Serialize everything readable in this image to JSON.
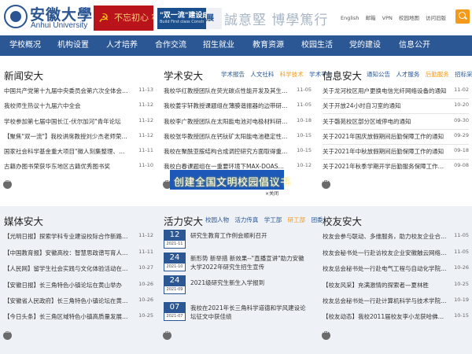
{
  "header": {
    "logo_cn": "安徽大學",
    "logo_en": "Anhui University",
    "banner1": "不忘初心 牢记使命",
    "banner2_title": "\"双一流\"建设成果展",
    "banner2_sub": "Build First class Construction Achievement Exhibition",
    "banner2_tail": "展",
    "motto": "誠意堅 博學篤行",
    "toplinks": [
      "English",
      "邮箱",
      "VPN",
      "校园地图",
      "访问旧版"
    ]
  },
  "nav": [
    "学校概况",
    "机构设置",
    "人才培养",
    "合作交流",
    "招生就业",
    "教育资源",
    "校园生活",
    "党的建设",
    "信息公开"
  ],
  "news": {
    "title": "新闻安大",
    "items": [
      {
        "t": "中国共产党第十九届中央委员会第六次全体会议...",
        "d": "11-13"
      },
      {
        "t": "我校师生热议十九届六中全会",
        "d": "11-12"
      },
      {
        "t": "学校参加第七届中国长江-伏尔加河\"青年论坛",
        "d": "11-12"
      },
      {
        "t": "【聚焦\"双一流\"】我校讲席教授刘少杰老师荣获...",
        "d": "11-12"
      },
      {
        "t": "国家社会科学基金重大项目\"徽人刻集整理、研究...\"",
        "d": "11-11"
      },
      {
        "t": "古籍办图书荣获华东地区古籍优秀图书奖",
        "d": "11-10"
      }
    ]
  },
  "academic": {
    "title": "学术安大",
    "tabs": [
      "学术报告",
      "人文社科",
      "科学技术",
      "学术平台"
    ],
    "active_tab": 2,
    "items": [
      {
        "t": "我校华红教授团队在荧光碳点性能开发及其生物...",
        "d": "11-05"
      },
      {
        "t": "我校姜宇轩教授课题组在薄膜谐振器的边带研究...",
        "d": "11-05"
      },
      {
        "t": "我校李广教授团队在太阳能电池对电极材料研究...",
        "d": "10-18"
      },
      {
        "t": "我校张华教授团队在钙钛矿太阳能电池稳定性和...",
        "d": "10-15"
      },
      {
        "t": "我校在聚酰亚胺结构合成调控研究方面取得重...",
        "d": "10-15"
      },
      {
        "t": "我校白春课题组在一重要环境下MAX-DOAS反演...",
        "d": "10-12"
      }
    ],
    "popup_text": "创建全国文明校园倡议书",
    "popup_close": "×关闭"
  },
  "notice": {
    "title": "信息安大",
    "tabs": [
      "通知公告",
      "人才服务",
      "后勤服务",
      "招标采购"
    ],
    "active_tab": 2,
    "items": [
      {
        "t": "关于龙河校区用户更换电信光纤网络设备的通知",
        "d": "11-02"
      },
      {
        "t": "关于开放24小时自习室的通知",
        "d": "10-20"
      },
      {
        "t": "关于磬苑校区部分区域停电的通知",
        "d": "09-30"
      },
      {
        "t": "关于2021年国庆放假期间后勤保障工作的通知",
        "d": "09-29"
      },
      {
        "t": "关于2021年中秋放假期间后勤保障工作的通知",
        "d": "09-18"
      },
      {
        "t": "关于2021年秋季学期开学后勤服务保障工作的通知",
        "d": "09-08"
      }
    ]
  },
  "media": {
    "title": "媒体安大",
    "items": [
      {
        "t": "【光明日报】探索学科专业建设校际合作新路径...",
        "d": "11-12"
      },
      {
        "t": "【中国教育报】安徽高校：智慧思政谱写育人新...",
        "d": "11-11"
      },
      {
        "t": "【人民网】留学生社会实践与文化体验活动在合...",
        "d": "10-27"
      },
      {
        "t": "【安徽日报】长三角特色小镇论坛在黄山举办",
        "d": "10-26"
      },
      {
        "t": "【安徽省人民政府】长三角特色小镇论坛在黄山...",
        "d": "10-26"
      },
      {
        "t": "【今日头条】长三角区域特色小镇高质量发展论...",
        "d": "10-25"
      }
    ]
  },
  "vigor": {
    "title": "活力安大",
    "tabs": [
      "校园人物",
      "活力传真",
      "学工部",
      "研工部",
      "团委"
    ],
    "active_tab": 3,
    "items": [
      {
        "day": "12",
        "ym": "2021-11",
        "t": "研究生教育工作例会顺利召开"
      },
      {
        "day": "24",
        "ym": "2021-10",
        "t": "新形势 新举措 新效果--\"直播宣讲\"助力安徽大学2022年研究生招生宣传"
      },
      {
        "day": "24",
        "ym": "2021-09",
        "t": "2021级研究生新生入学报到"
      },
      {
        "day": "07",
        "ym": "2021-07",
        "t": "我校在2021年长三角科学道德和学风建设论坛征文中获佳绩"
      }
    ]
  },
  "friends": {
    "title": "校友安大",
    "items": [
      {
        "t": "校友会参与联动、多维服务，助力校友企业合肥...",
        "d": "11-05"
      },
      {
        "t": "校友会秘书处一行赴访校友企业安徽触云网络科...",
        "d": "11-05"
      },
      {
        "t": "校友总会秘书处一行赴电气工程与自动化学院调...",
        "d": "10-26"
      },
      {
        "t": "【校友风采】充满激情的探索者—夏林胜",
        "d": "10-25"
      },
      {
        "t": "校友总会秘书处一行赴计算机科学与技术学院调...",
        "d": "10-19"
      },
      {
        "t": "【校友动态】我校2011届校友李小龙获哈佛华人...",
        "d": "10-15"
      }
    ]
  }
}
